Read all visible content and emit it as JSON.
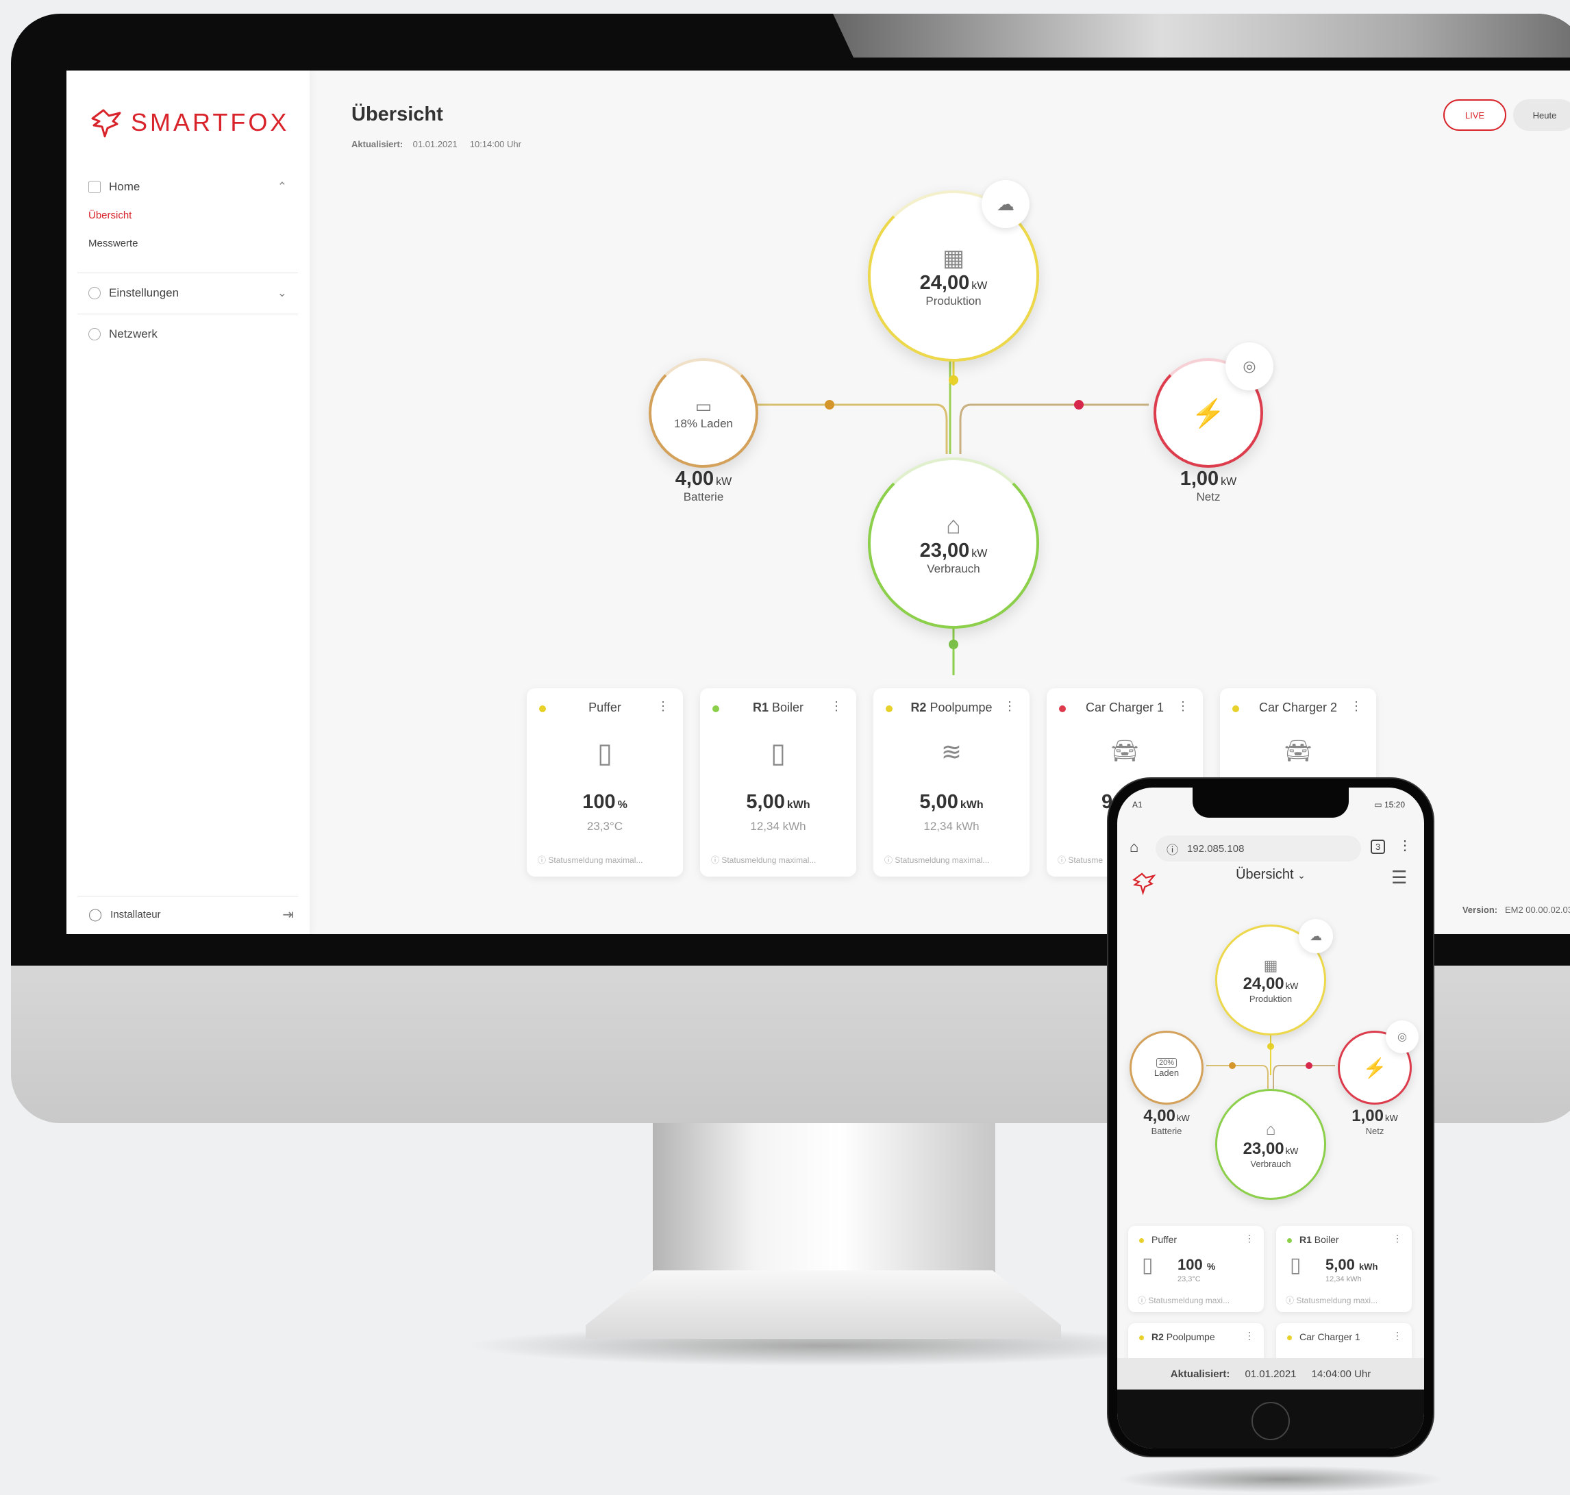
{
  "brand": {
    "name": "SMARTFOX",
    "accent": "#d8232a"
  },
  "sidebar": {
    "items": [
      {
        "label": "Home",
        "icon": "grid-icon",
        "expanded": true
      },
      {
        "label": "Übersicht",
        "active": true
      },
      {
        "label": "Messwerte"
      },
      {
        "label": "Einstellungen",
        "icon": "gear-icon"
      },
      {
        "label": "Netzwerk",
        "icon": "globe-icon"
      }
    ],
    "user": {
      "label": "Installateur",
      "icon": "user-icon",
      "action_icon": "logout-icon"
    }
  },
  "header": {
    "title": "Übersicht",
    "updated_label": "Aktualisiert:",
    "updated_date": "01.01.2021",
    "updated_time": "10:14:00 Uhr",
    "live_label": "LIVE",
    "today_label": "Heute"
  },
  "flow": {
    "production": {
      "value": "24,00",
      "unit": "kW",
      "label": "Produktion",
      "color": "#ecd84a"
    },
    "battery": {
      "inner": "18% Laden",
      "value": "4,00",
      "unit": "kW",
      "label": "Batterie",
      "color": "#d4a15a"
    },
    "grid": {
      "value": "1,00",
      "unit": "kW",
      "label": "Netz",
      "color": "#dc3c4c"
    },
    "consumption": {
      "value": "23,00",
      "unit": "kW",
      "label": "Verbrauch",
      "color": "#8ccf4a"
    }
  },
  "devices": [
    {
      "prefix": "",
      "name": "Puffer",
      "status_color": "#e8d12a",
      "value": "100",
      "unit": "%",
      "sub": "23,3°C",
      "status": "Statusmeldung maximal..."
    },
    {
      "prefix": "R1",
      "name": "Boiler",
      "status_color": "#8ccf4a",
      "value": "5,00",
      "unit": "kWh",
      "sub": "12,34 kWh",
      "status": "Statusmeldung maximal..."
    },
    {
      "prefix": "R2",
      "name": "Poolpumpe",
      "status_color": "#e8d12a",
      "value": "5,00",
      "unit": "kWh",
      "sub": "12,34 kWh",
      "status": "Statusmeldung maximal..."
    },
    {
      "prefix": "",
      "name": "Car Charger 1",
      "status_color": "#dc3c4c",
      "value": "9",
      "unit": "",
      "sub": "",
      "status": "Statusme"
    },
    {
      "prefix": "",
      "name": "Car Charger 2",
      "status_color": "#e8d12a",
      "value": "",
      "unit": "",
      "sub": "",
      "status": ""
    }
  ],
  "footer": {
    "version_label": "Version:",
    "version_value": "EM2 00.00.02.03",
    "partial_left": "M"
  },
  "phone": {
    "carrier": "A1",
    "time": "15:20",
    "url": "192.085.108",
    "tab_count": "3",
    "title": "Übersicht",
    "production": {
      "value": "24,00",
      "unit": "kW",
      "label": "Produktion"
    },
    "battery": {
      "inner_pct": "20%",
      "inner": "Laden",
      "value": "4,00",
      "unit": "kW",
      "label": "Batterie"
    },
    "grid": {
      "value": "1,00",
      "unit": "kW",
      "label": "Netz"
    },
    "consumption": {
      "value": "23,00",
      "unit": "kW",
      "label": "Verbrauch"
    },
    "cards": [
      {
        "prefix": "",
        "name": "Puffer",
        "value": "100",
        "unit": "%",
        "sub": "23,3°C",
        "status": "Statusmeldung maxi..."
      },
      {
        "prefix": "R1",
        "name": "Boiler",
        "value": "5,00",
        "unit": "kWh",
        "sub": "12,34 kWh",
        "status": "Statusmeldung maxi..."
      },
      {
        "prefix": "R2",
        "name": "Poolpumpe"
      },
      {
        "prefix": "",
        "name": "Car Charger 1"
      }
    ],
    "updated_label": "Aktualisiert:",
    "updated_date": "01.01.2021",
    "updated_time": "14:04:00 Uhr"
  }
}
